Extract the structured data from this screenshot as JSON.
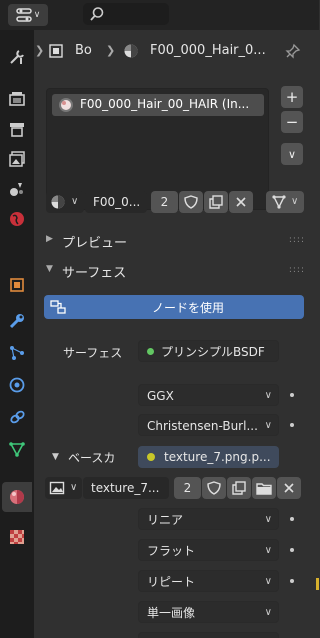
{
  "header": {
    "search_placeholder": ""
  },
  "breadcrumb": {
    "object_name": "Bo",
    "material_name": "F00_000_Hair_0..."
  },
  "material_slots": {
    "items": [
      {
        "label": "F00_000_Hair_00_HAIR (In..."
      }
    ]
  },
  "material_selector": {
    "name": "F00_0...",
    "user_count": "2"
  },
  "sections": {
    "preview": "プレビュー",
    "surface": "サーフェス"
  },
  "use_nodes_label": "ノードを使用",
  "surface": {
    "label": "サーフェス",
    "shader": "プリンシプルBSDF"
  },
  "distribution": "GGX",
  "subsurface_method": "Christensen-Burl...",
  "base_color": {
    "label": "ベースカ",
    "texture": "texture_7.png.p..."
  },
  "image_selector": {
    "name": "texture_7...",
    "user_count": "2"
  },
  "image_settings": {
    "interpolation": "リニア",
    "projection": "フラット",
    "extension": "リピート",
    "source": "単一画像"
  },
  "colors": {
    "accent": "#4772b3",
    "sidebar": "#1d1d1d",
    "panel": "#303030",
    "field": "#545454",
    "green_socket": "#63c763",
    "yellow_socket": "#c7c729"
  }
}
